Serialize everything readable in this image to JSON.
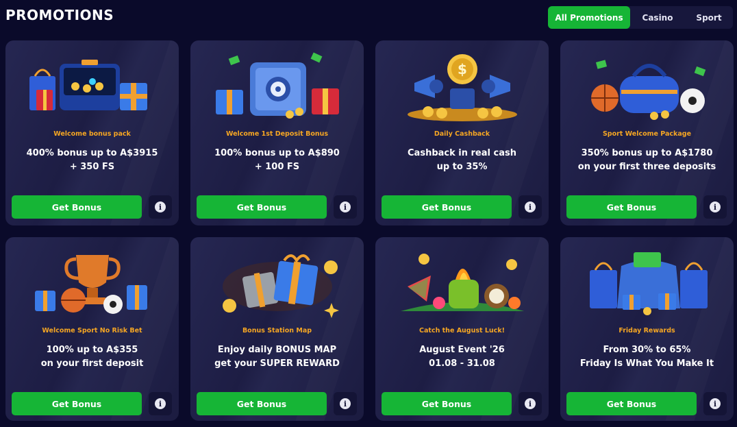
{
  "page": {
    "title": "PROMOTIONS"
  },
  "tabs": [
    {
      "label": "All Promotions",
      "active": true
    },
    {
      "label": "Casino",
      "active": false
    },
    {
      "label": "Sport",
      "active": false
    }
  ],
  "colors": {
    "accent": "#16b536",
    "subtitle": "#f5a623",
    "background": "#0a0a2a",
    "card": "#22234c"
  },
  "cards": [
    {
      "art": "gift-suitcase-art",
      "subtitle": "Welcome bonus pack",
      "line1": "400% bonus up to A$3915",
      "line2": "+ 350 FS",
      "button": "Get Bonus",
      "info_icon": "info-icon"
    },
    {
      "art": "safe-art",
      "subtitle": "Welcome 1st Deposit Bonus",
      "line1": "100% bonus up to A$890",
      "line2": "+ 100 FS",
      "button": "Get Bonus",
      "info_icon": "info-icon"
    },
    {
      "art": "megaphone-coins-art",
      "subtitle": "Daily Cashback",
      "line1": "Cashback in real cash",
      "line2": "up to 35%",
      "button": "Get Bonus",
      "info_icon": "info-icon"
    },
    {
      "art": "sport-bag-art",
      "subtitle": "Sport Welcome Package",
      "line1": "350% bonus up to A$1780",
      "line2": "on your first three deposits",
      "button": "Get Bonus",
      "info_icon": "info-icon"
    },
    {
      "art": "trophy-art",
      "subtitle": "Welcome Sport No Risk Bet",
      "line1": "100% up to A$355",
      "line2": "on your first deposit",
      "button": "Get Bonus",
      "info_icon": "info-icon"
    },
    {
      "art": "gift-boxes-art",
      "subtitle": "Bonus Station Map",
      "line1": "Enjoy daily BONUS MAP",
      "line2": "get your SUPER REWARD",
      "button": "Get Bonus",
      "info_icon": "info-icon"
    },
    {
      "art": "tropical-cocktail-art",
      "subtitle": "Catch the August Luck!",
      "line1": "August Event '26",
      "line2": "01.08 - 31.08",
      "button": "Get Bonus",
      "info_icon": "info-icon"
    },
    {
      "art": "shopping-bags-art",
      "subtitle": "Friday Rewards",
      "line1": "From 30% to 65%",
      "line2": "Friday Is What You Make It",
      "button": "Get Bonus",
      "info_icon": "info-icon"
    }
  ]
}
